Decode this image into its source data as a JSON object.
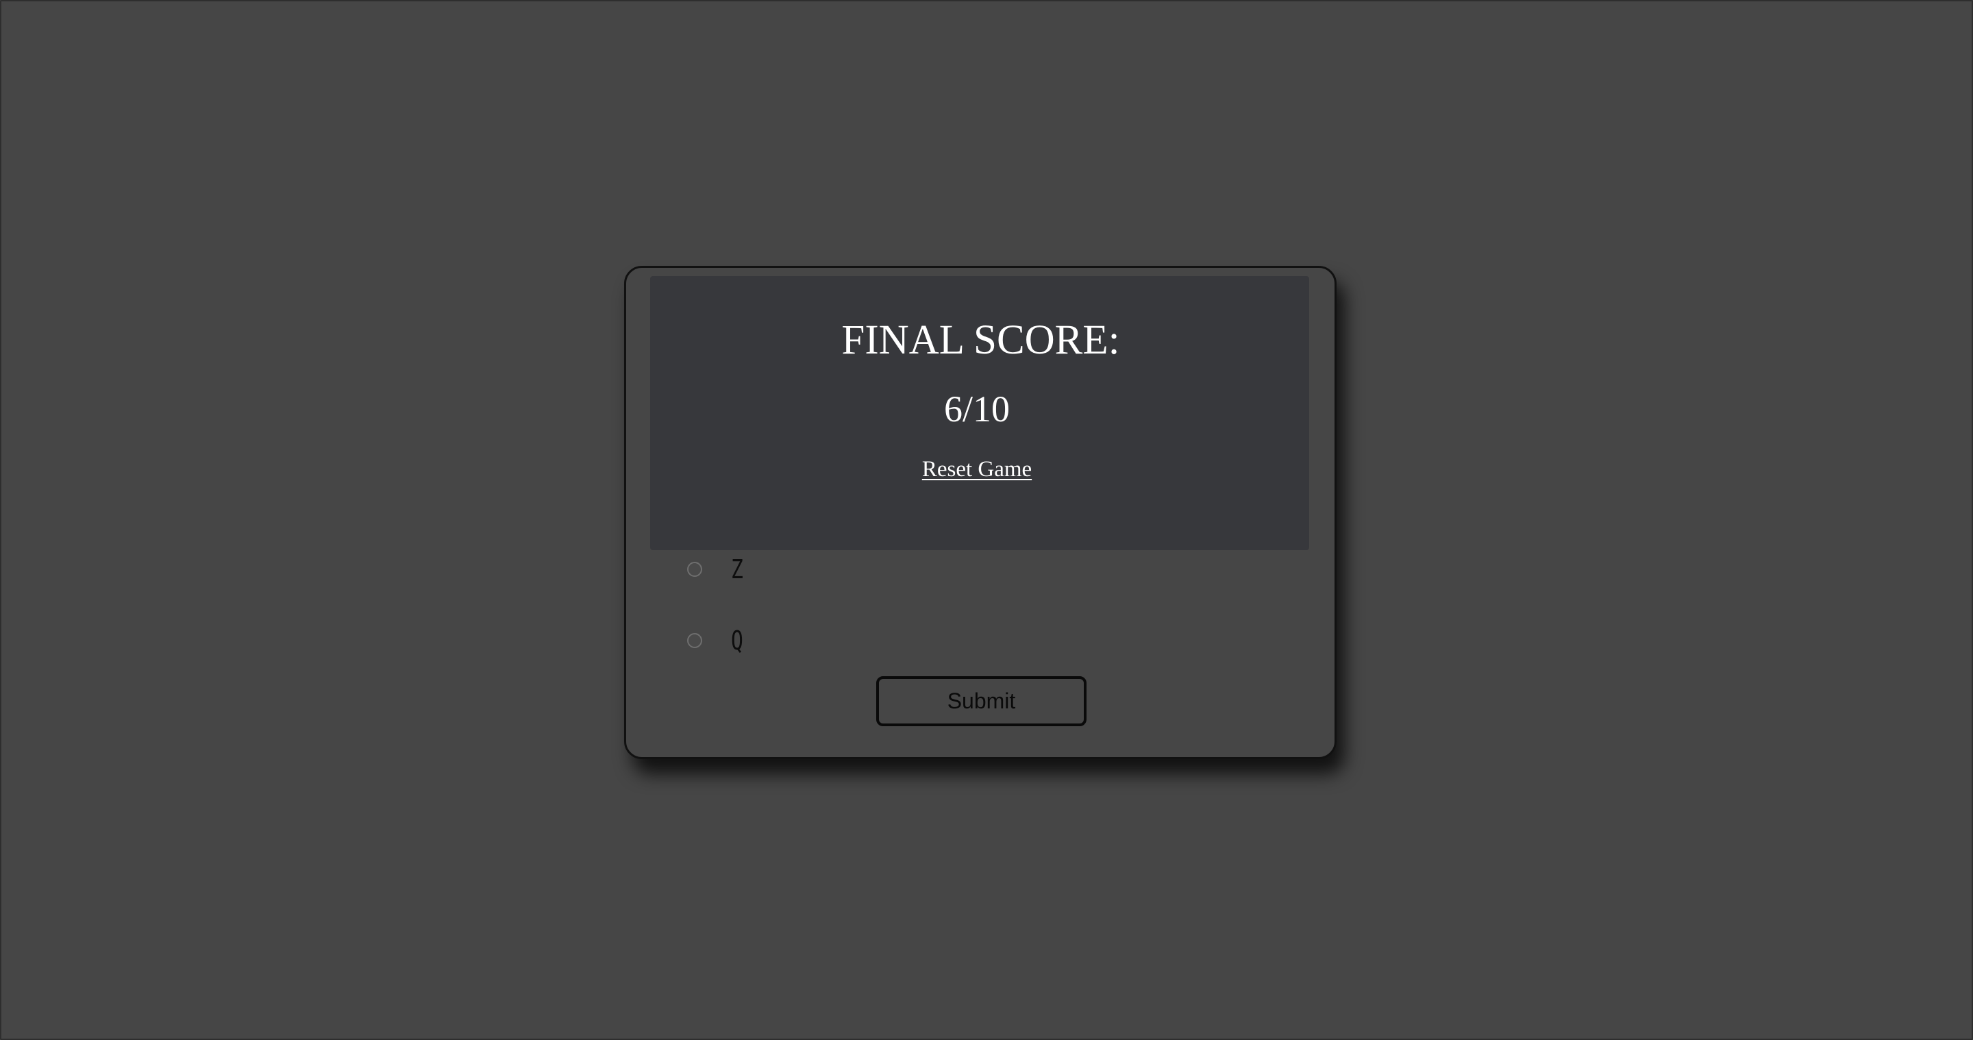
{
  "quiz": {
    "options": [
      {
        "label": "Z",
        "selected": false
      },
      {
        "label": "Q",
        "selected": false
      }
    ],
    "submit_label": "Submit"
  },
  "score_panel": {
    "heading": "FINAL SCORE:",
    "score": "6/10",
    "reset_label": "Reset Game"
  },
  "colors": {
    "page_background": "#464646",
    "card_background": "#464646",
    "overlay_background": "#37383c",
    "overlay_text": "#ffffff",
    "card_border": "#111111"
  }
}
